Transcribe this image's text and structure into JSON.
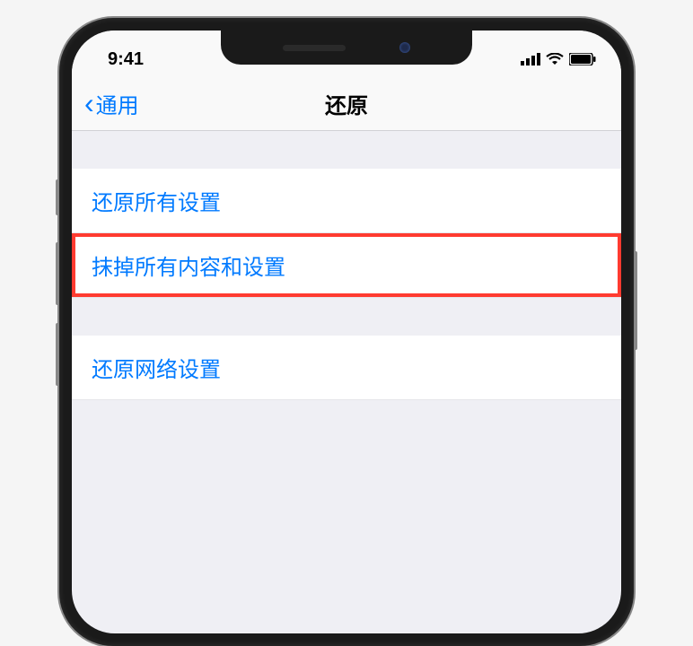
{
  "status_bar": {
    "time": "9:41"
  },
  "nav": {
    "back_label": "通用",
    "title": "还原"
  },
  "items": {
    "reset_all_settings": "还原所有设置",
    "erase_all_content": "抹掉所有内容和设置",
    "reset_network_settings": "还原网络设置"
  }
}
